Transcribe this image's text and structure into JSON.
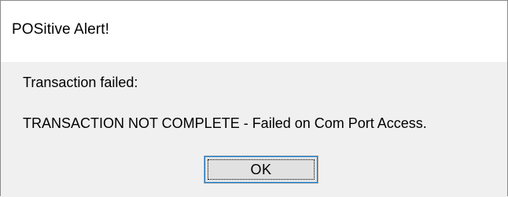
{
  "dialog": {
    "title": "POSitive Alert!",
    "message_line1": "Transaction failed:",
    "message_line2": "TRANSACTION NOT COMPLETE - Failed on Com Port Access.",
    "ok_label": "OK"
  },
  "colors": {
    "title_background": "#ffffff",
    "body_background": "#f0f0f0",
    "button_background": "#e1e1e1",
    "button_focus_border": "#0078d7",
    "window_border": "#8a8a8a"
  }
}
